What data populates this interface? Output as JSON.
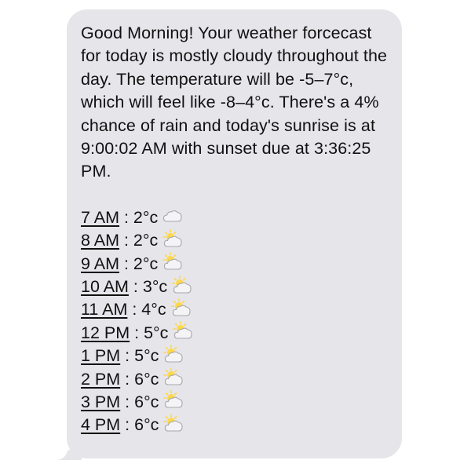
{
  "message": {
    "text": "Good Morning! Your weather forcecast for today is mostly cloudy throughout the day. The temperature will be -5–7°c, which will feel like -8–4°c. There's a 4% chance of rain and today's sunrise is at 9:00:02 AM with sunset due at 3:36:25 PM.",
    "separator": " : ",
    "forecast": [
      {
        "time": "7 AM",
        "temp": "2°c",
        "icon": "cloud-icon"
      },
      {
        "time": "8 AM",
        "temp": "2°c",
        "icon": "sun-behind-cloud-icon"
      },
      {
        "time": "9 AM",
        "temp": "2°c",
        "icon": "sun-behind-cloud-icon"
      },
      {
        "time": "10 AM",
        "temp": "3°c",
        "icon": "sun-behind-cloud-icon"
      },
      {
        "time": "11 AM",
        "temp": "4°c",
        "icon": "sun-behind-cloud-icon"
      },
      {
        "time": "12 PM",
        "temp": "5°c",
        "icon": "sun-behind-cloud-icon"
      },
      {
        "time": "1 PM",
        "temp": "5°c",
        "icon": "sun-behind-cloud-icon"
      },
      {
        "time": "2 PM",
        "temp": "6°c",
        "icon": "sun-behind-cloud-icon"
      },
      {
        "time": "3 PM",
        "temp": "6°c",
        "icon": "sun-behind-cloud-icon"
      },
      {
        "time": "4 PM",
        "temp": "6°c",
        "icon": "sun-behind-cloud-icon"
      }
    ]
  },
  "colors": {
    "bubble_background": "#e5e5ea",
    "text": "#111111",
    "cloud": "#f4f4f6",
    "cloud_outline": "#a9a9ae",
    "sun": "#ffd84a"
  }
}
